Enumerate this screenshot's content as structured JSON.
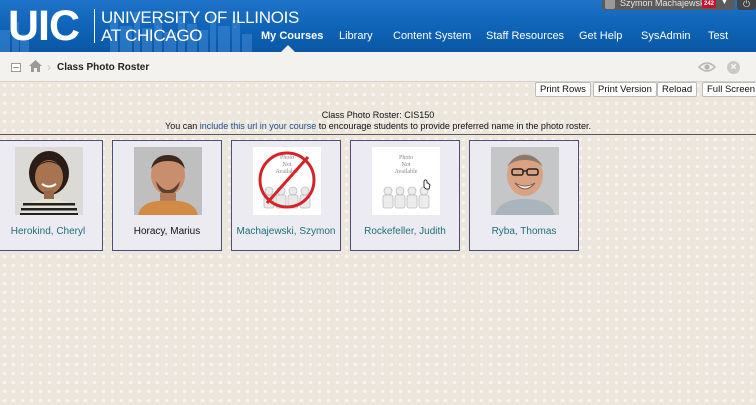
{
  "header": {
    "logo": "UIC",
    "university_line1": "UNIVERSITY OF ILLINOIS",
    "university_line2": "AT CHICAGO",
    "nav": [
      "My Courses",
      "Library",
      "Content System",
      "Staff Resources",
      "Get Help",
      "SysAdmin",
      "Test"
    ],
    "active_nav": "My Courses",
    "user_name": "Szymon Machajewski",
    "notification_count": "242",
    "brand_color": "#0e63b6"
  },
  "breadcrumb": {
    "title": "Class Photo Roster"
  },
  "toolbar": {
    "print_rows": "Print Rows",
    "print_version": "Print Version",
    "reload": "Reload",
    "full_screen": "Full Screen"
  },
  "roster": {
    "title": "Class Photo Roster: CIS150",
    "sub_before": "You can ",
    "sub_link": "include this url in your course",
    "sub_after": " to encourage students to provide preferred name in the photo roster."
  },
  "students": [
    {
      "name": "Herokind, Cheryl",
      "photo": "portrait"
    },
    {
      "name": "Horacy, Marius",
      "photo": "portrait"
    },
    {
      "name": "Machajewski, Szymon",
      "photo": "not-available-crossed"
    },
    {
      "name": "Rockefeller, Judith",
      "photo": "not-available"
    },
    {
      "name": "Ryba, Thomas",
      "photo": "portrait"
    }
  ],
  "photo_placeholder": {
    "line1": "Photo",
    "line2": "Not",
    "line3": "Available"
  }
}
